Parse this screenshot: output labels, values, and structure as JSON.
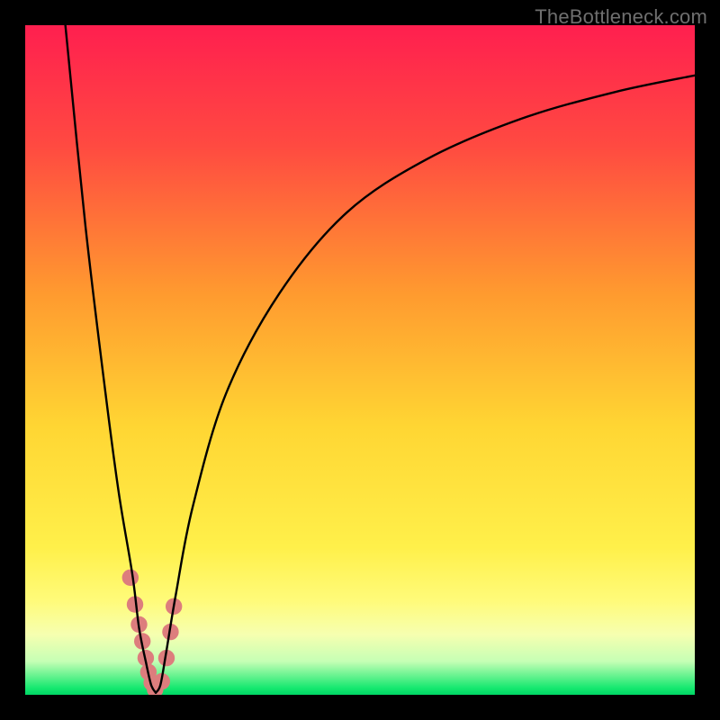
{
  "watermark": "TheBottleneck.com",
  "chart_data": {
    "type": "line",
    "title": "",
    "xlabel": "",
    "ylabel": "",
    "xlim": [
      0,
      100
    ],
    "ylim": [
      0,
      100
    ],
    "gradient_stops": [
      {
        "pct": 0,
        "color": "#ff1f4f"
      },
      {
        "pct": 18,
        "color": "#ff4a41"
      },
      {
        "pct": 40,
        "color": "#ff9a2f"
      },
      {
        "pct": 60,
        "color": "#ffd633"
      },
      {
        "pct": 78,
        "color": "#fff04a"
      },
      {
        "pct": 86,
        "color": "#fffb7a"
      },
      {
        "pct": 91,
        "color": "#f6ffb0"
      },
      {
        "pct": 95,
        "color": "#c6ffb5"
      },
      {
        "pct": 99,
        "color": "#15e86f"
      },
      {
        "pct": 100,
        "color": "#00d665"
      }
    ],
    "series": [
      {
        "name": "left-branch",
        "x": [
          6.0,
          9.0,
          12.0,
          14.0,
          16.0,
          17.0,
          18.0,
          18.8,
          19.5
        ],
        "y": [
          100,
          70,
          45,
          30,
          18,
          10,
          5,
          1.5,
          0.3
        ]
      },
      {
        "name": "right-branch",
        "x": [
          19.5,
          20.2,
          21.0,
          22.5,
          25.0,
          30.0,
          38.0,
          48.0,
          60.0,
          74.0,
          88.0,
          100.0
        ],
        "y": [
          0.3,
          1.5,
          6,
          15,
          28,
          45,
          60,
          72,
          80,
          86,
          90,
          92.5
        ]
      }
    ],
    "marker_points": {
      "name": "highlight-dots",
      "color": "#dd7d7d",
      "points": [
        {
          "x": 15.7,
          "y": 17.5
        },
        {
          "x": 16.4,
          "y": 13.5
        },
        {
          "x": 17.0,
          "y": 10.5
        },
        {
          "x": 17.5,
          "y": 8.0
        },
        {
          "x": 18.0,
          "y": 5.5
        },
        {
          "x": 18.4,
          "y": 3.4
        },
        {
          "x": 18.9,
          "y": 1.8
        },
        {
          "x": 19.4,
          "y": 0.8
        },
        {
          "x": 20.4,
          "y": 2.0
        },
        {
          "x": 21.1,
          "y": 5.5
        },
        {
          "x": 21.7,
          "y": 9.4
        },
        {
          "x": 22.2,
          "y": 13.2
        }
      ]
    }
  }
}
